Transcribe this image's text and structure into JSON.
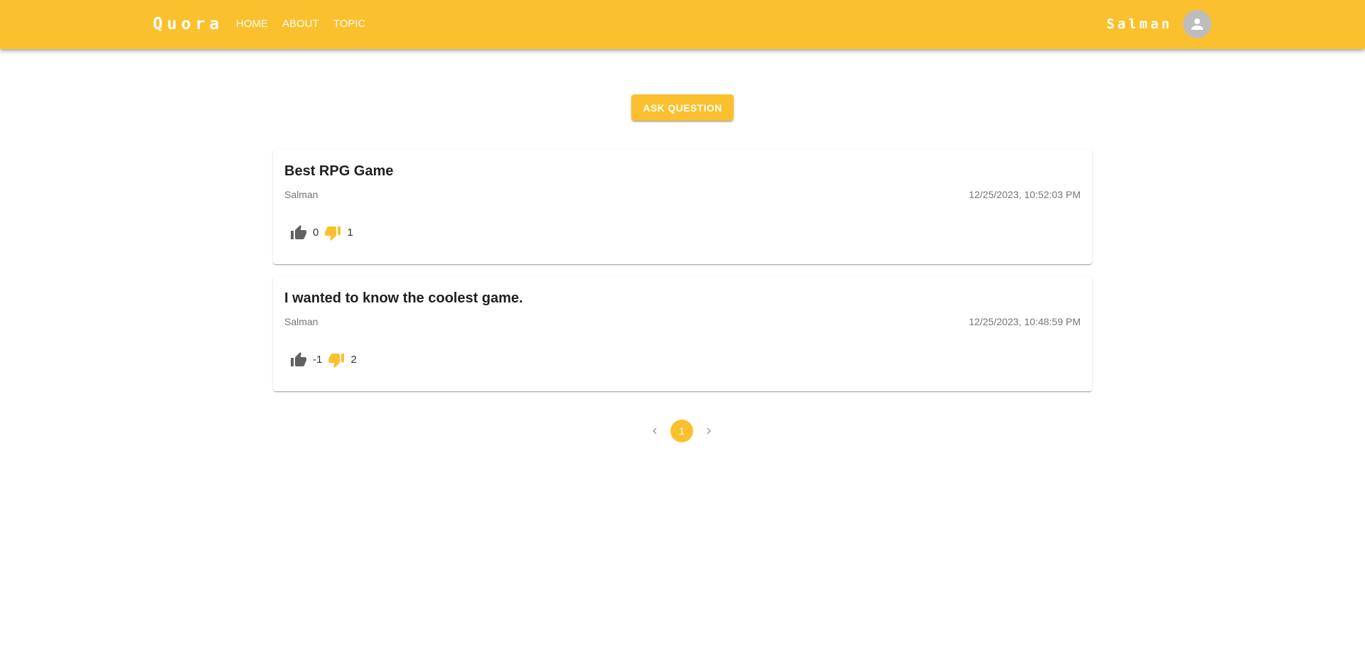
{
  "header": {
    "brand": "Quora",
    "nav": [
      {
        "label": "HOME"
      },
      {
        "label": "ABOUT"
      },
      {
        "label": "TOPIC"
      }
    ],
    "user_name": "Salman",
    "avatar_icon": "account-circle-icon",
    "background_color": "#fbc02d"
  },
  "main": {
    "ask_button_label": "ASK QUESTION",
    "questions": [
      {
        "title": "Best RPG Game",
        "author": "Salman",
        "date": "12/25/2023, 10:52:03 PM",
        "upvotes": "0",
        "downvotes": "1"
      },
      {
        "title": "I wanted to know the coolest game.",
        "author": "Salman",
        "date": "12/25/2023, 10:48:59 PM",
        "upvotes": "-1",
        "downvotes": "2"
      }
    ],
    "icons": {
      "upvote": "thumb-up-icon",
      "downvote": "thumb-down-icon"
    }
  },
  "pagination": {
    "current_page": "1",
    "prev_icon": "chevron-left-icon",
    "next_icon": "chevron-right-icon"
  }
}
